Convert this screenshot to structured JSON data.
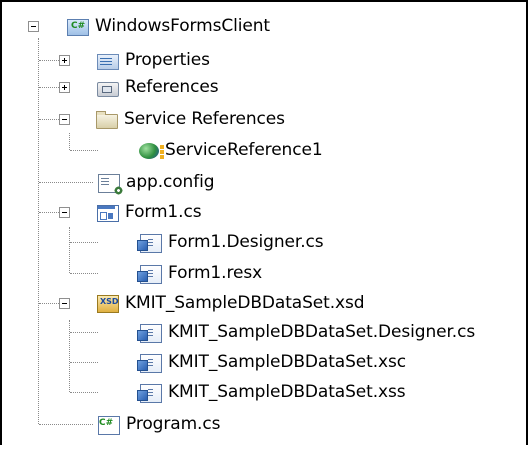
{
  "solution_explorer": {
    "project": {
      "label": "WindowsFormsClient",
      "icon": "csharp-project-icon",
      "expanded": true,
      "icon_text": "C#"
    },
    "items": [
      {
        "id": "properties",
        "label": "Properties",
        "icon": "properties-icon",
        "expanded": false
      },
      {
        "id": "references",
        "label": "References",
        "icon": "references-icon",
        "expanded": false
      },
      {
        "id": "service-references",
        "label": "Service References",
        "icon": "folder-icon",
        "expanded": true,
        "children": [
          {
            "id": "servicereference1",
            "label": "ServiceReference1",
            "icon": "service-reference-icon"
          }
        ]
      },
      {
        "id": "app-config",
        "label": "app.config",
        "icon": "config-file-icon"
      },
      {
        "id": "form1",
        "label": "Form1.cs",
        "icon": "form-icon",
        "expanded": true,
        "children": [
          {
            "id": "form1-designer",
            "label": "Form1.Designer.cs",
            "icon": "code-file-icon"
          },
          {
            "id": "form1-resx",
            "label": "Form1.resx",
            "icon": "code-file-icon"
          }
        ]
      },
      {
        "id": "dataset",
        "label": "KMIT_SampleDBDataSet.xsd",
        "icon": "dataset-icon",
        "expanded": true,
        "icon_text": "XSD",
        "children": [
          {
            "id": "dataset-designer",
            "label": "KMIT_SampleDBDataSet.Designer.cs",
            "icon": "code-file-icon"
          },
          {
            "id": "dataset-xsc",
            "label": "KMIT_SampleDBDataSet.xsc",
            "icon": "code-file-icon"
          },
          {
            "id": "dataset-xss",
            "label": "KMIT_SampleDBDataSet.xss",
            "icon": "code-file-icon"
          }
        ]
      },
      {
        "id": "program",
        "label": "Program.cs",
        "icon": "csharp-file-icon",
        "icon_text": "C#"
      }
    ]
  }
}
